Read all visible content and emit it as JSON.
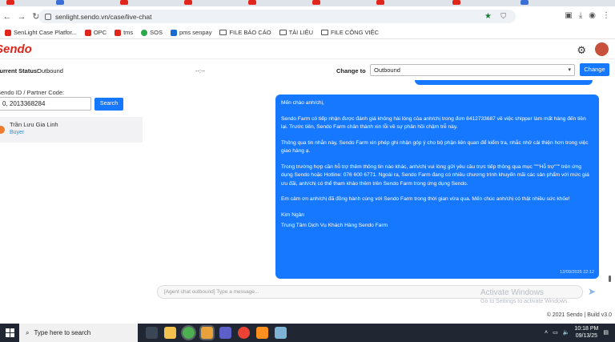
{
  "browser": {
    "url": "senlight.sendo.vn/case/live-chat",
    "bookmarks": [
      {
        "label": "SenLight Case Platfor...",
        "color": "#e1251b",
        "folder": false
      },
      {
        "label": "OPC",
        "color": "#e1251b",
        "folder": false
      },
      {
        "label": "tms",
        "color": "#e1251b",
        "folder": false
      },
      {
        "label": "SOS",
        "color": "#2aa84a",
        "folder": false
      },
      {
        "label": "pms senpay",
        "color": "#1a6bd1",
        "folder": false
      },
      {
        "label": "FILE BÁO CÁO",
        "color": "",
        "folder": true
      },
      {
        "label": "TÀI LIỆU",
        "color": "",
        "folder": true
      },
      {
        "label": "FILE CÔNG VIỆC",
        "color": "",
        "folder": true
      }
    ]
  },
  "header": {
    "logo": "Sendo",
    "icons": [
      "gear-icon",
      "avatar"
    ]
  },
  "status": {
    "label": "Current Status:",
    "value": "Outbound",
    "dash": "--:--",
    "change_label": "Change to",
    "change_value": "Outbound",
    "change_button": "Change"
  },
  "search": {
    "label": "Sendo ID / Partner Code:",
    "value": "0, 2013368284",
    "button": "Search"
  },
  "contact": {
    "name": "Trần Lưu Gia Linh",
    "role": "Buyer"
  },
  "message": {
    "paragraphs": [
      "Mến chào anh/chị,",
      "Sendo Farm có tiếp nhận được đánh giá không hài lòng của anh/chị trong đơn 8412733687 về việc shipper làm mất hàng đến tiền lại. Trước tiên, Sendo Farm chân thành xin lỗi về sự phản hồi chậm trễ này.",
      "Thông qua tin nhắn này, Sendo Farm xin phép ghi nhận góp ý cho bộ phận liên quan để kiểm tra, nhắc nhở cải thiện hơn trong việc giao hàng ạ.",
      "Trong trường hợp cần hỗ trợ thêm thông tin nào khác, anh/chị vui lòng gửi yêu cầu trực tiếp thông qua mục \"\"\"Hỗ trợ\"\"\" trên ứng dụng Sendo hoặc Hotline: 076 600 6771. Ngoài ra, Sendo Farm đang có nhiều chương trình khuyến mãi các sản phẩm với mức giá ưu đãi, anh/chị có thể tham khảo thêm trên Sendo Farm trong ứng dụng Sendo.",
      "Em cảm ơn anh/chị đã đồng hành cùng với Sendo Farm trong thời gian vừa qua. Mến chúc anh/chị có thật nhiều sức khỏe!"
    ],
    "signature_name": "Kim Ngân",
    "signature_team": "Trung Tâm Dịch Vụ Khách Hàng Sendo Farm",
    "time": "12/09/2025 22:12"
  },
  "chat_input": {
    "placeholder": "[Agent chat outbound] Type a message..."
  },
  "watermark": {
    "line1": "Activate Windows",
    "line2": "Go to Settings to activate Windows."
  },
  "footer": {
    "text": "© 2021 Sendo | Build v3.0"
  },
  "taskbar": {
    "search_placeholder": "Type here to search",
    "time": "10:18 PM",
    "date": "09/13/25",
    "apps": [
      {
        "name": "task-view-icon",
        "color": "#3a4556"
      },
      {
        "name": "file-explorer-icon",
        "color": "#f2c14e"
      },
      {
        "name": "chrome-icon",
        "color": "#4caf50"
      },
      {
        "name": "folder-icon",
        "color": "#e9a23b"
      },
      {
        "name": "teams-icon",
        "color": "#5b5fc7"
      },
      {
        "name": "chrome-alt-icon",
        "color": "#ea4335"
      },
      {
        "name": "sublime-icon",
        "color": "#ff8f1f"
      },
      {
        "name": "notepad-icon",
        "color": "#7fb3d5"
      }
    ]
  },
  "colors": {
    "brand": "#e1251b",
    "accent": "#1677ff"
  }
}
